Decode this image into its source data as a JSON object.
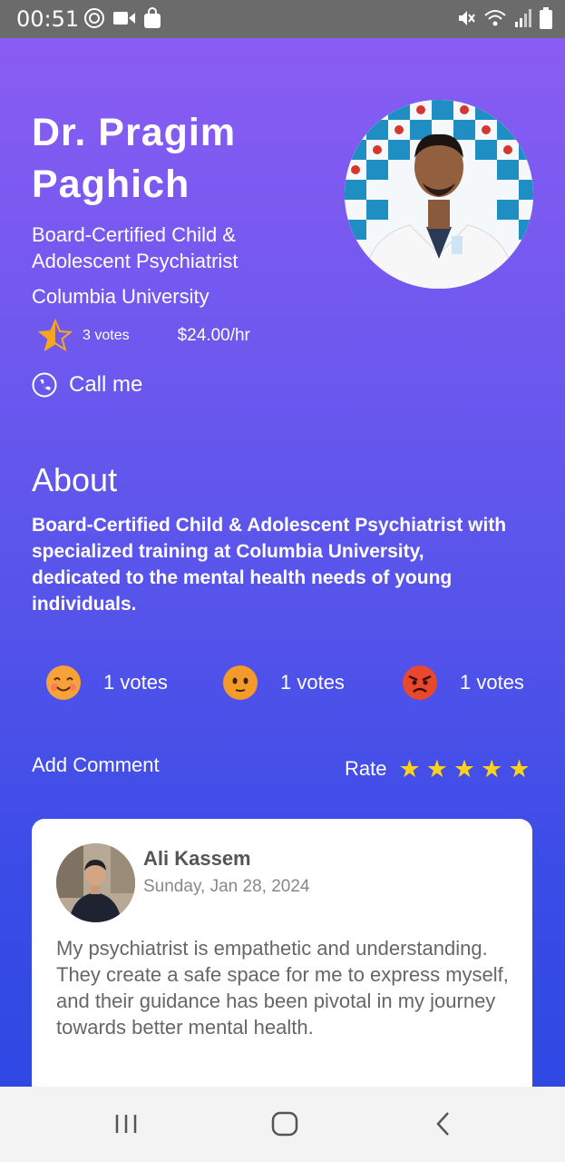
{
  "status": {
    "time": "00:51",
    "left_icons": [
      "vpn-icon",
      "video-icon",
      "shopping-bag-icon"
    ],
    "right_icons": [
      "mute-icon",
      "wifi-icon",
      "signal-icon",
      "battery-icon"
    ]
  },
  "doctor": {
    "name": "Dr. Pragim Paghich",
    "specialty": "Board-Certified Child & Adolescent Psychiatrist",
    "university": "Columbia University",
    "rating_fraction": 0.5,
    "votes": "3 votes",
    "price": "$24.00/hr",
    "call_label": "Call me"
  },
  "about": {
    "heading": "About",
    "text": "Board-Certified Child & Adolescent Psychiatrist with specialized training at Columbia University, dedicated to the mental health needs of young individuals."
  },
  "reactions": [
    {
      "icon": "smiling-face-icon",
      "label": "1 votes"
    },
    {
      "icon": "neutral-face-icon",
      "label": "1 votes"
    },
    {
      "icon": "angry-face-icon",
      "label": "1 votes"
    }
  ],
  "actions": {
    "add_comment": "Add Comment",
    "rate_label": "Rate",
    "rate_stars": 5
  },
  "comment": {
    "author": "Ali Kassem",
    "date": "Sunday, Jan 28, 2024",
    "text": "My psychiatrist is empathetic and understanding. They create a safe space for me to express myself, and their guidance has been pivotal in my journey towards better mental health."
  },
  "nav": [
    "recent-apps-icon",
    "home-icon",
    "back-icon"
  ],
  "colors": {
    "gradient_top": "#8a5cf3",
    "gradient_bottom": "#2f48e4",
    "star_yellow": "#ffd21a",
    "rating_star": "#f5a623"
  }
}
